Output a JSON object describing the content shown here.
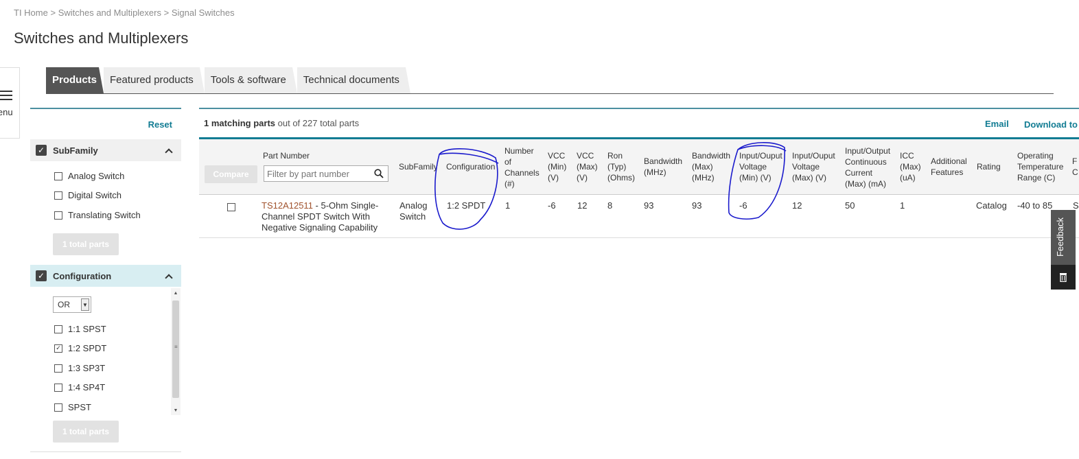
{
  "breadcrumb": {
    "items": [
      "TI Home",
      "Switches and Multiplexers",
      "Signal Switches"
    ],
    "separator": ">"
  },
  "page_title": "Switches and Multiplexers",
  "side_menu": {
    "label": "lenu"
  },
  "tabs": [
    {
      "label": "Products",
      "active": true
    },
    {
      "label": "Featured products",
      "active": false
    },
    {
      "label": "Tools & software",
      "active": false
    },
    {
      "label": "Technical documents",
      "active": false
    }
  ],
  "filters": {
    "reset_label": "Reset",
    "subfamily": {
      "title": "SubFamily",
      "options": [
        {
          "label": "Analog Switch",
          "checked": false
        },
        {
          "label": "Digital Switch",
          "checked": false
        },
        {
          "label": "Translating Switch",
          "checked": false
        }
      ],
      "total_label": "1 total parts"
    },
    "configuration": {
      "title": "Configuration",
      "operator": "OR",
      "options": [
        {
          "label": "1:1 SPST",
          "checked": false
        },
        {
          "label": "1:2 SPDT",
          "checked": true
        },
        {
          "label": "1:3 SP3T",
          "checked": false
        },
        {
          "label": "1:4 SP4T",
          "checked": false
        },
        {
          "label": "SPST",
          "checked": false
        }
      ],
      "total_label": "1 total parts"
    }
  },
  "results": {
    "match_count": "1 matching parts",
    "match_suffix": " out of 227 total parts",
    "email_label": "Email",
    "download_label": "Download to",
    "compare_label": "Compare",
    "filter_placeholder": "Filter by part number"
  },
  "table": {
    "headers": {
      "part_number": "Part Number",
      "subfamily": "SubFamily",
      "configuration": "Configuration",
      "channels": [
        "Number",
        "of",
        "Channels",
        "(#)"
      ],
      "vcc_min": [
        "VCC",
        "(Min)",
        "(V)"
      ],
      "vcc_max": [
        "VCC",
        "(Max)",
        "(V)"
      ],
      "ron": [
        "Ron",
        "(Typ)",
        "(Ohms)"
      ],
      "bandwidth": [
        "Bandwidth",
        "(MHz)"
      ],
      "bandwidth_max": [
        "Bandwidth",
        "(Max)",
        "(MHz)"
      ],
      "io_voltage_min": [
        "Input/Ouput",
        "Voltage",
        "(Min) (V)"
      ],
      "io_voltage_max": [
        "Input/Ouput",
        "Voltage",
        "(Max) (V)"
      ],
      "io_current": [
        "Input/Output",
        "Continuous",
        "Current",
        "(Max) (mA)"
      ],
      "icc": [
        "ICC",
        "(Max)",
        "(uA)"
      ],
      "additional": [
        "Additional",
        "Features"
      ],
      "rating": "Rating",
      "temp": [
        "Operating",
        "Temperature",
        "Range (C)"
      ],
      "cut": [
        "F",
        "C"
      ]
    },
    "row": {
      "part_id": "TS12A12511",
      "part_desc_1": " - 5-Ohm Single-",
      "part_desc_2": "Channel SPDT Switch With",
      "part_desc_3": "Negative Signaling Capability",
      "subfamily": [
        "Analog",
        "Switch"
      ],
      "configuration": "1:2 SPDT",
      "channels": "1",
      "vcc_min": "-6",
      "vcc_max": "12",
      "ron": "8",
      "bandwidth": "93",
      "bandwidth_max": "93",
      "io_voltage_min": "-6",
      "io_voltage_max": "12",
      "io_current": "50",
      "icc": "1",
      "additional": "",
      "rating": "Catalog",
      "temp": "-40 to 85",
      "cut": "S"
    }
  },
  "feedback": {
    "label": "Feedback",
    "icon": "trash-icon"
  },
  "colors": {
    "accent": "#127c93",
    "annotation": "#1a1acc",
    "tab_active": "#555555"
  }
}
